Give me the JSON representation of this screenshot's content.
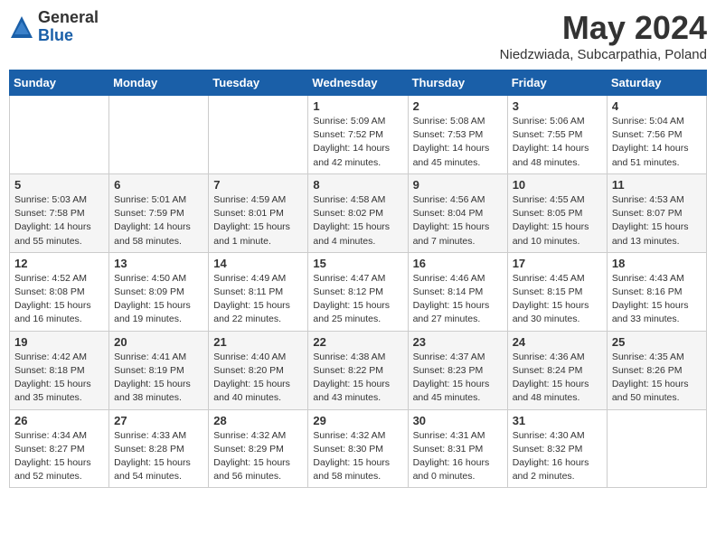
{
  "logo": {
    "general": "General",
    "blue": "Blue"
  },
  "header": {
    "month": "May 2024",
    "location": "Niedzwiada, Subcarpathia, Poland"
  },
  "weekdays": [
    "Sunday",
    "Monday",
    "Tuesday",
    "Wednesday",
    "Thursday",
    "Friday",
    "Saturday"
  ],
  "weeks": [
    [
      {
        "day": "",
        "info": ""
      },
      {
        "day": "",
        "info": ""
      },
      {
        "day": "",
        "info": ""
      },
      {
        "day": "1",
        "info": "Sunrise: 5:09 AM\nSunset: 7:52 PM\nDaylight: 14 hours\nand 42 minutes."
      },
      {
        "day": "2",
        "info": "Sunrise: 5:08 AM\nSunset: 7:53 PM\nDaylight: 14 hours\nand 45 minutes."
      },
      {
        "day": "3",
        "info": "Sunrise: 5:06 AM\nSunset: 7:55 PM\nDaylight: 14 hours\nand 48 minutes."
      },
      {
        "day": "4",
        "info": "Sunrise: 5:04 AM\nSunset: 7:56 PM\nDaylight: 14 hours\nand 51 minutes."
      }
    ],
    [
      {
        "day": "5",
        "info": "Sunrise: 5:03 AM\nSunset: 7:58 PM\nDaylight: 14 hours\nand 55 minutes."
      },
      {
        "day": "6",
        "info": "Sunrise: 5:01 AM\nSunset: 7:59 PM\nDaylight: 14 hours\nand 58 minutes."
      },
      {
        "day": "7",
        "info": "Sunrise: 4:59 AM\nSunset: 8:01 PM\nDaylight: 15 hours\nand 1 minute."
      },
      {
        "day": "8",
        "info": "Sunrise: 4:58 AM\nSunset: 8:02 PM\nDaylight: 15 hours\nand 4 minutes."
      },
      {
        "day": "9",
        "info": "Sunrise: 4:56 AM\nSunset: 8:04 PM\nDaylight: 15 hours\nand 7 minutes."
      },
      {
        "day": "10",
        "info": "Sunrise: 4:55 AM\nSunset: 8:05 PM\nDaylight: 15 hours\nand 10 minutes."
      },
      {
        "day": "11",
        "info": "Sunrise: 4:53 AM\nSunset: 8:07 PM\nDaylight: 15 hours\nand 13 minutes."
      }
    ],
    [
      {
        "day": "12",
        "info": "Sunrise: 4:52 AM\nSunset: 8:08 PM\nDaylight: 15 hours\nand 16 minutes."
      },
      {
        "day": "13",
        "info": "Sunrise: 4:50 AM\nSunset: 8:09 PM\nDaylight: 15 hours\nand 19 minutes."
      },
      {
        "day": "14",
        "info": "Sunrise: 4:49 AM\nSunset: 8:11 PM\nDaylight: 15 hours\nand 22 minutes."
      },
      {
        "day": "15",
        "info": "Sunrise: 4:47 AM\nSunset: 8:12 PM\nDaylight: 15 hours\nand 25 minutes."
      },
      {
        "day": "16",
        "info": "Sunrise: 4:46 AM\nSunset: 8:14 PM\nDaylight: 15 hours\nand 27 minutes."
      },
      {
        "day": "17",
        "info": "Sunrise: 4:45 AM\nSunset: 8:15 PM\nDaylight: 15 hours\nand 30 minutes."
      },
      {
        "day": "18",
        "info": "Sunrise: 4:43 AM\nSunset: 8:16 PM\nDaylight: 15 hours\nand 33 minutes."
      }
    ],
    [
      {
        "day": "19",
        "info": "Sunrise: 4:42 AM\nSunset: 8:18 PM\nDaylight: 15 hours\nand 35 minutes."
      },
      {
        "day": "20",
        "info": "Sunrise: 4:41 AM\nSunset: 8:19 PM\nDaylight: 15 hours\nand 38 minutes."
      },
      {
        "day": "21",
        "info": "Sunrise: 4:40 AM\nSunset: 8:20 PM\nDaylight: 15 hours\nand 40 minutes."
      },
      {
        "day": "22",
        "info": "Sunrise: 4:38 AM\nSunset: 8:22 PM\nDaylight: 15 hours\nand 43 minutes."
      },
      {
        "day": "23",
        "info": "Sunrise: 4:37 AM\nSunset: 8:23 PM\nDaylight: 15 hours\nand 45 minutes."
      },
      {
        "day": "24",
        "info": "Sunrise: 4:36 AM\nSunset: 8:24 PM\nDaylight: 15 hours\nand 48 minutes."
      },
      {
        "day": "25",
        "info": "Sunrise: 4:35 AM\nSunset: 8:26 PM\nDaylight: 15 hours\nand 50 minutes."
      }
    ],
    [
      {
        "day": "26",
        "info": "Sunrise: 4:34 AM\nSunset: 8:27 PM\nDaylight: 15 hours\nand 52 minutes."
      },
      {
        "day": "27",
        "info": "Sunrise: 4:33 AM\nSunset: 8:28 PM\nDaylight: 15 hours\nand 54 minutes."
      },
      {
        "day": "28",
        "info": "Sunrise: 4:32 AM\nSunset: 8:29 PM\nDaylight: 15 hours\nand 56 minutes."
      },
      {
        "day": "29",
        "info": "Sunrise: 4:32 AM\nSunset: 8:30 PM\nDaylight: 15 hours\nand 58 minutes."
      },
      {
        "day": "30",
        "info": "Sunrise: 4:31 AM\nSunset: 8:31 PM\nDaylight: 16 hours\nand 0 minutes."
      },
      {
        "day": "31",
        "info": "Sunrise: 4:30 AM\nSunset: 8:32 PM\nDaylight: 16 hours\nand 2 minutes."
      },
      {
        "day": "",
        "info": ""
      }
    ]
  ],
  "alt_rows": [
    1,
    3
  ]
}
